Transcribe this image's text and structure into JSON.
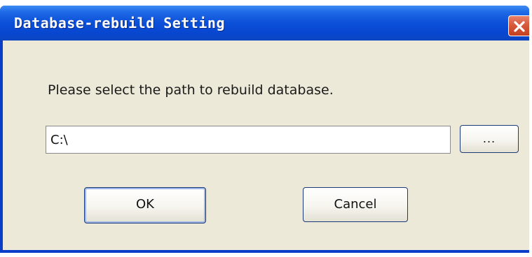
{
  "window": {
    "title": "Database-rebuild Setting"
  },
  "dialog": {
    "prompt": "Please select the path to rebuild database.",
    "path_value": "C:\\",
    "browse_label": "...",
    "ok_label": "OK",
    "cancel_label": "Cancel"
  },
  "icons": {
    "close": "close-icon"
  },
  "colors": {
    "titlebar": "#0b4fd8",
    "client_background": "#ece9d8",
    "close_button": "#d65a3c"
  }
}
